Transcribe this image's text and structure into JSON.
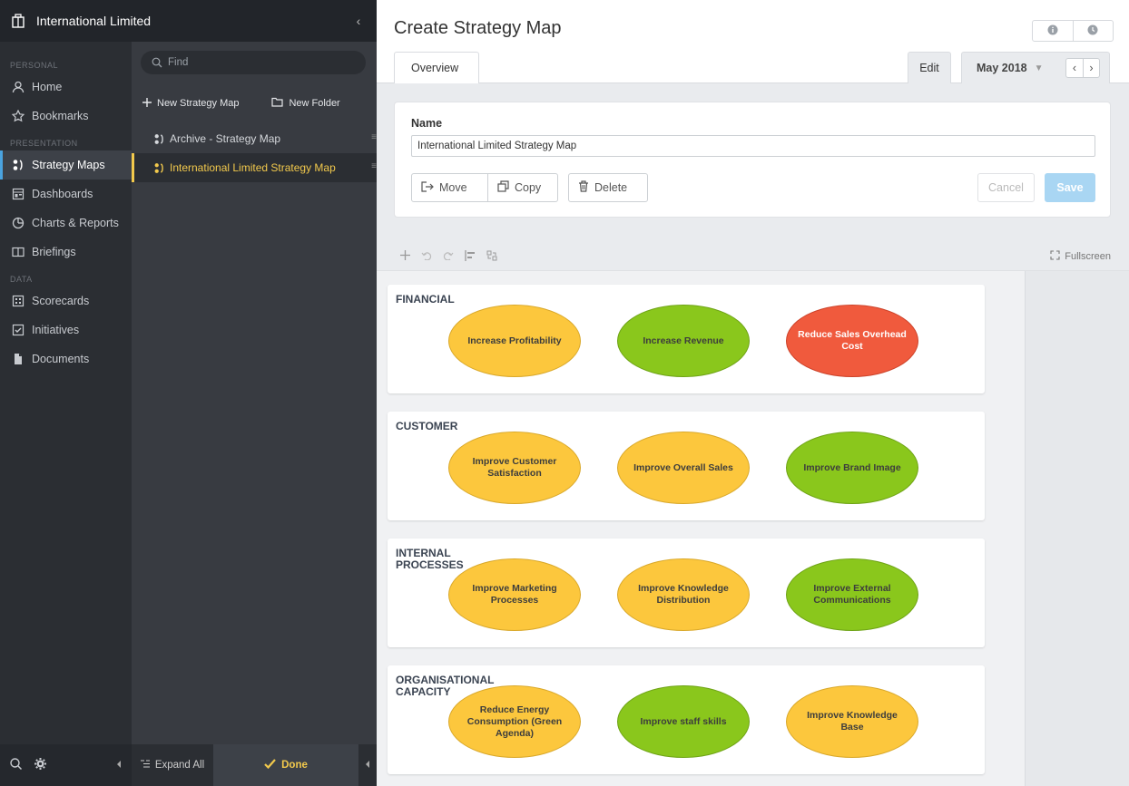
{
  "app": {
    "org_name": "International Limited",
    "collapse_glyph": "‹"
  },
  "nav": {
    "sections": [
      {
        "label": "PERSONAL",
        "items": [
          {
            "label": "Home",
            "icon": "user-icon"
          },
          {
            "label": "Bookmarks",
            "icon": "star-icon"
          }
        ]
      },
      {
        "label": "PRESENTATION",
        "items": [
          {
            "label": "Strategy Maps",
            "icon": "strategy-map-icon",
            "active": true
          },
          {
            "label": "Dashboards",
            "icon": "dashboard-icon"
          },
          {
            "label": "Charts & Reports",
            "icon": "pie-chart-icon"
          },
          {
            "label": "Briefings",
            "icon": "book-icon"
          }
        ]
      },
      {
        "label": "DATA",
        "items": [
          {
            "label": "Scorecards",
            "icon": "scorecard-icon"
          },
          {
            "label": "Initiatives",
            "icon": "checkbox-icon"
          },
          {
            "label": "Documents",
            "icon": "document-icon"
          }
        ]
      }
    ]
  },
  "tree": {
    "search_placeholder": "Find",
    "new_map_label": "New Strategy Map",
    "new_folder_label": "New Folder",
    "items": [
      {
        "label": "Archive - Strategy Map",
        "selected": false
      },
      {
        "label": "International Limited Strategy Map",
        "selected": true
      }
    ],
    "expand_all_label": "Expand All",
    "done_label": "Done"
  },
  "header": {
    "title": "Create Strategy Map",
    "tab_overview": "Overview",
    "tab_edit": "Edit",
    "period": "May 2018",
    "prev_glyph": "‹",
    "next_glyph": "›"
  },
  "form": {
    "name_label": "Name",
    "name_value": "International Limited Strategy Map",
    "move_label": "Move",
    "copy_label": "Copy",
    "delete_label": "Delete",
    "cancel_label": "Cancel",
    "save_label": "Save"
  },
  "toolbar": {
    "fullscreen_label": "Fullscreen"
  },
  "colors": {
    "accent": "#4aa3df",
    "selected": "#f2c94c",
    "status_yellow": "#fcc73d",
    "status_green": "#8ac71c",
    "status_red": "#f05a3d"
  },
  "perspectives": [
    {
      "title": "FINANCIAL",
      "objectives": [
        {
          "label": "Increase Profitability",
          "status": "yellow"
        },
        {
          "label": "Increase Revenue",
          "status": "green"
        },
        {
          "label": "Reduce Sales Overhead Cost",
          "status": "red"
        }
      ]
    },
    {
      "title": "CUSTOMER",
      "objectives": [
        {
          "label": "Improve Customer Satisfaction",
          "status": "yellow"
        },
        {
          "label": "Improve Overall Sales",
          "status": "yellow"
        },
        {
          "label": "Improve Brand Image",
          "status": "green"
        }
      ]
    },
    {
      "title": "INTERNAL PROCESSES",
      "objectives": [
        {
          "label": "Improve Marketing Processes",
          "status": "yellow"
        },
        {
          "label": "Improve Knowledge Distribution",
          "status": "yellow"
        },
        {
          "label": "Improve External Communications",
          "status": "green"
        }
      ]
    },
    {
      "title": "ORGANISATIONAL CAPACITY",
      "objectives": [
        {
          "label": "Reduce Energy Consumption (Green Agenda)",
          "status": "yellow"
        },
        {
          "label": "Improve staff skills",
          "status": "green"
        },
        {
          "label": "Improve Knowledge Base",
          "status": "yellow"
        }
      ]
    }
  ]
}
